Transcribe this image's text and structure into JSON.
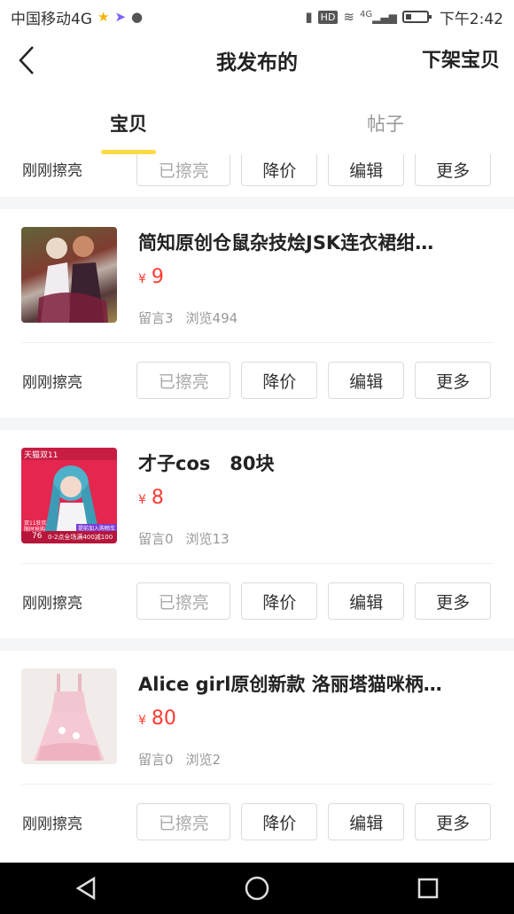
{
  "status_bar": {
    "carrier": "中国移动4G",
    "time": "下午2:42",
    "hd": "HD",
    "net": "4G"
  },
  "header": {
    "title": "我发布的",
    "action": "下架宝贝"
  },
  "tabs": [
    {
      "label": "宝贝",
      "active": true
    },
    {
      "label": "帖子",
      "active": false
    }
  ],
  "buttons": {
    "polished": "已擦亮",
    "reduce_price": "降价",
    "edit": "编辑",
    "more": "更多"
  },
  "partial_row": {
    "label": "刚刚擦亮"
  },
  "items": [
    {
      "title": "简知原创仓鼠杂技烩JSK连衣裙绀…",
      "currency": "¥",
      "price": "9",
      "comments": "留言3",
      "views": "浏览494",
      "status": "刚刚擦亮"
    },
    {
      "title": "才子cos   80块",
      "currency": "¥",
      "price": "8",
      "comments": "留言0",
      "views": "浏览13",
      "status": "刚刚擦亮",
      "thumb_text": {
        "badge": "天猫双11",
        "left_lines": [
          "双11狂欢",
          "限时抢购"
        ],
        "price": "76",
        "cart": "提前加入购物车",
        "promo": "0-2点全场满400减100"
      }
    },
    {
      "title": "Alice girl原创新款 洛丽塔猫咪柄…",
      "currency": "¥",
      "price": "80",
      "comments": "留言0",
      "views": "浏览2",
      "status": "刚刚擦亮"
    }
  ],
  "colors": {
    "accent_yellow": "#ffda44",
    "price_red": "#ff3b30",
    "separator": "#f5f6f8"
  }
}
